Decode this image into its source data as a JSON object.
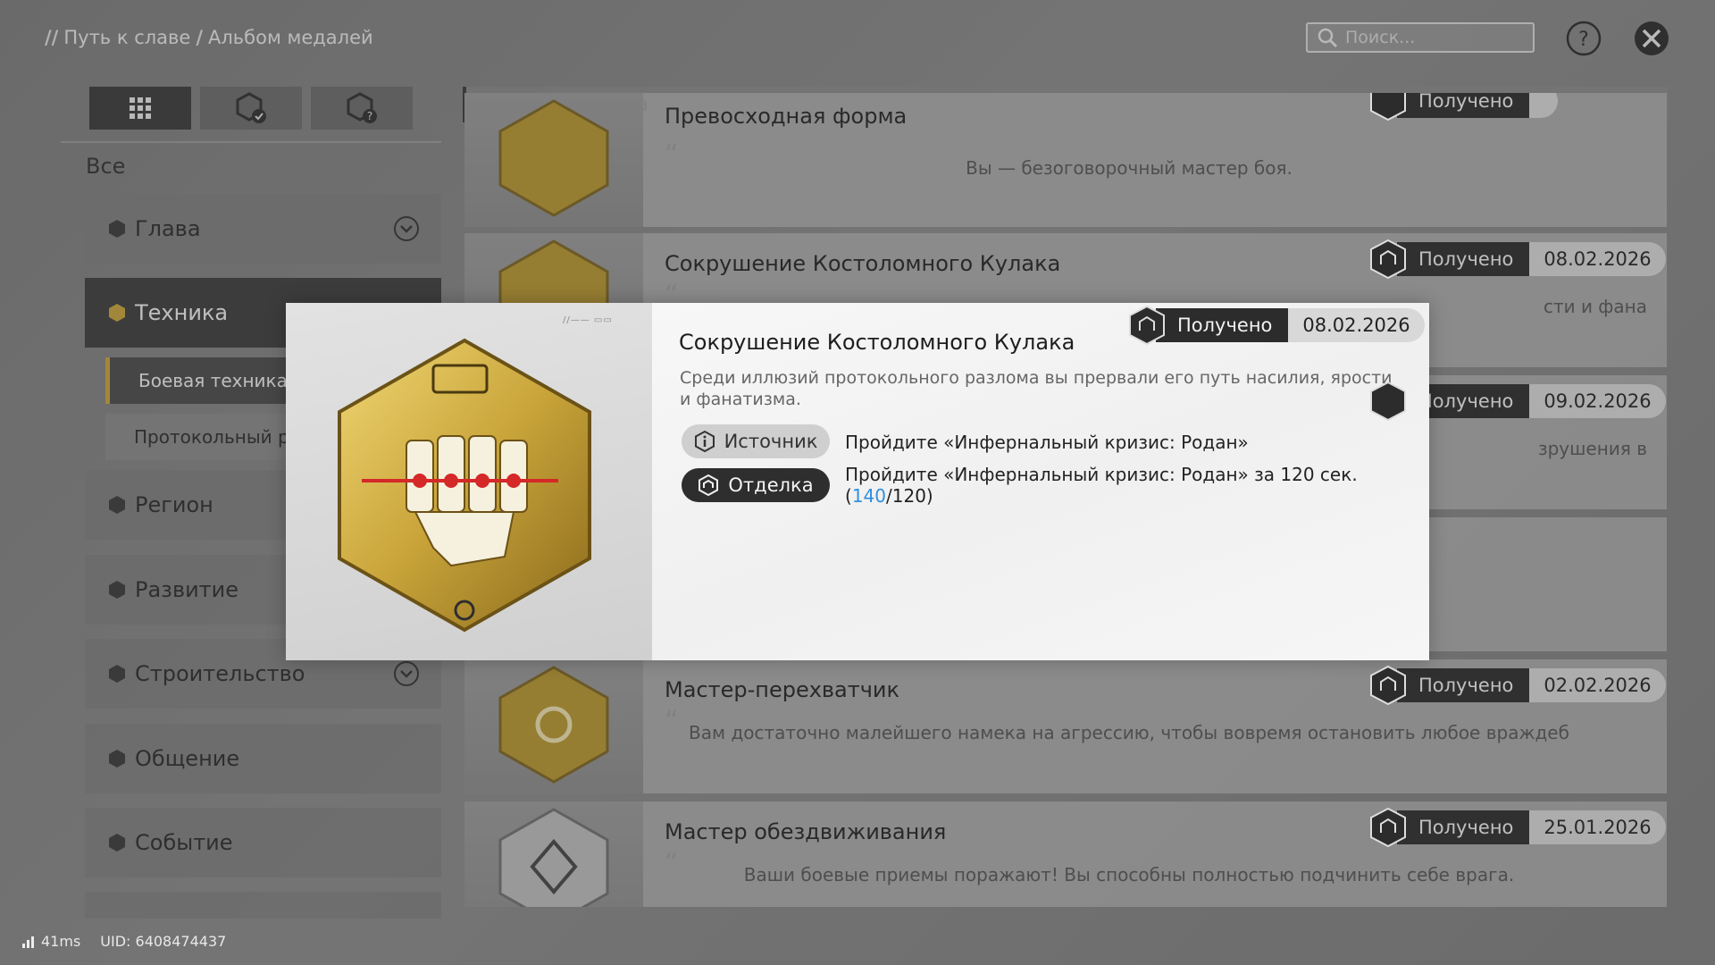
{
  "breadcrumb": {
    "prefix": "//",
    "item1": "Путь к славе",
    "sep": "/",
    "item2": "Альбом медалей"
  },
  "search": {
    "placeholder": "Поиск..."
  },
  "filter": {
    "all_label": "Все"
  },
  "sidebar": {
    "categories": [
      {
        "label": "Глава"
      },
      {
        "label": "Техника"
      },
      {
        "label": "Регион"
      },
      {
        "label": "Развитие"
      },
      {
        "label": "Строительство"
      },
      {
        "label": "Общение"
      },
      {
        "label": "Событие"
      }
    ],
    "subitems": [
      {
        "label": "Боевая техника"
      },
      {
        "label": "Протокольный р"
      }
    ]
  },
  "list": {
    "header": "Боевая техника",
    "cards": [
      {
        "title": "Превосходная форма",
        "desc": "Вы — безоговорочный мастер боя.",
        "status": "Получено",
        "date": ""
      },
      {
        "title": "Сокрушение Костоломного Кулака",
        "desc": "сти и фана",
        "status": "Получено",
        "date": "08.02.2026"
      },
      {
        "title": "",
        "desc": "зрушения в",
        "status": "Получено",
        "date": "09.02.2026"
      },
      {
        "title": "Мастер-перехватчик",
        "desc": "Вам достаточно малейшего намека на агрессию, чтобы вовремя остановить любое враждеб",
        "status": "Получено",
        "date": "02.02.2026"
      },
      {
        "title": "Мастер обездвиживания",
        "desc": "Ваши боевые приемы поражают! Вы способны полностью подчинить себе врага.",
        "status": "Получено",
        "date": "25.01.2026"
      }
    ]
  },
  "modal": {
    "title": "Сокрушение Костоломного Кулака",
    "description": "Среди иллюзий протокольного разлома вы прервали его путь насилия, ярости и фанатизма.",
    "status": "Получено",
    "date": "08.02.2026",
    "source_label": "Источник",
    "source_text": "Пройдите «Инфернальный кризис: Родан»",
    "finish_label": "Отделка",
    "finish_text": "Пройдите «Инфернальный кризис: Родан» за 120 сек.",
    "progress_open": "(",
    "progress_current": "140",
    "progress_total": "/120)"
  },
  "footer": {
    "ping": "41ms",
    "uid": "UID: 6408474437"
  },
  "colors": {
    "accent_gold": "#c9a43a",
    "progress_blue": "#2f8fe0",
    "dark_panel": "#2c2c2c"
  }
}
